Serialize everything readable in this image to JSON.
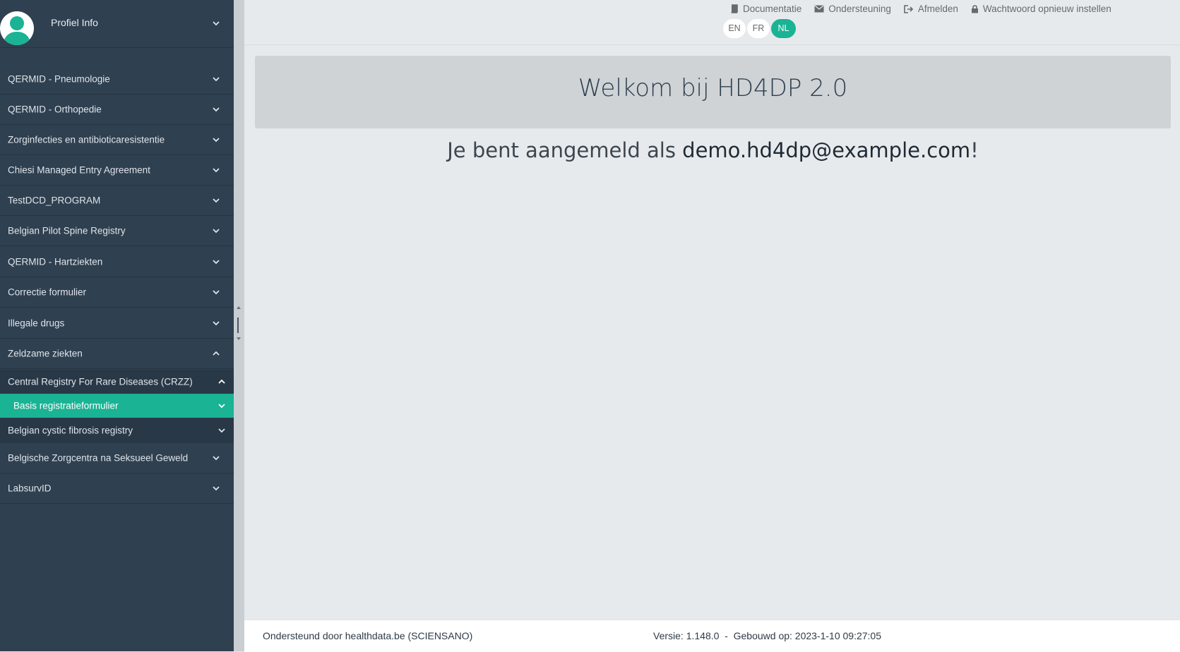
{
  "sidebar": {
    "profile_label": "Profiel Info",
    "items": [
      {
        "label": "QERMID - Pneumologie"
      },
      {
        "label": "QERMID - Orthopedie"
      },
      {
        "label": "Zorginfecties en antibioticaresistentie"
      },
      {
        "label": "Chiesi Managed Entry Agreement"
      },
      {
        "label": "TestDCD_PROGRAM"
      },
      {
        "label": "Belgian Pilot Spine Registry"
      },
      {
        "label": "QERMID - Hartziekten"
      },
      {
        "label": "Correctie formulier"
      },
      {
        "label": "Illegale drugs"
      },
      {
        "label": "Zeldzame ziekten"
      }
    ],
    "sub_items": [
      {
        "label": "Central Registry For Rare Diseases (CRZZ)"
      },
      {
        "label": "Basis registratieformulier"
      },
      {
        "label": "Belgian cystic fibrosis registry"
      }
    ],
    "items_after": [
      {
        "label": "Belgische Zorgcentra na Seksueel Geweld"
      },
      {
        "label": "LabsurvID"
      }
    ]
  },
  "topbar": {
    "links": {
      "documentation": "Documentatie",
      "support": "Ondersteuning",
      "logout": "Afmelden",
      "reset_password": "Wachtwoord opnieuw instellen"
    },
    "languages": [
      "EN",
      "FR",
      "NL"
    ],
    "active_language": "NL"
  },
  "main": {
    "welcome_title": "Welkom bij HD4DP 2.0",
    "logged_in_prefix": "Je bent aangemeld als ",
    "logged_in_email": "demo.hd4dp@example.com",
    "logged_in_suffix": "!"
  },
  "footer": {
    "supported_by": "Ondersteund door healthdata.be (SCIENSANO)",
    "version_build": "Versie: 1.148.0  -  Gebouwd op: 2023-1-10 09:27:05"
  },
  "colors": {
    "sidebar_bg": "#2f4050",
    "accent": "#1ab394",
    "page_bg": "#e7eaec"
  }
}
